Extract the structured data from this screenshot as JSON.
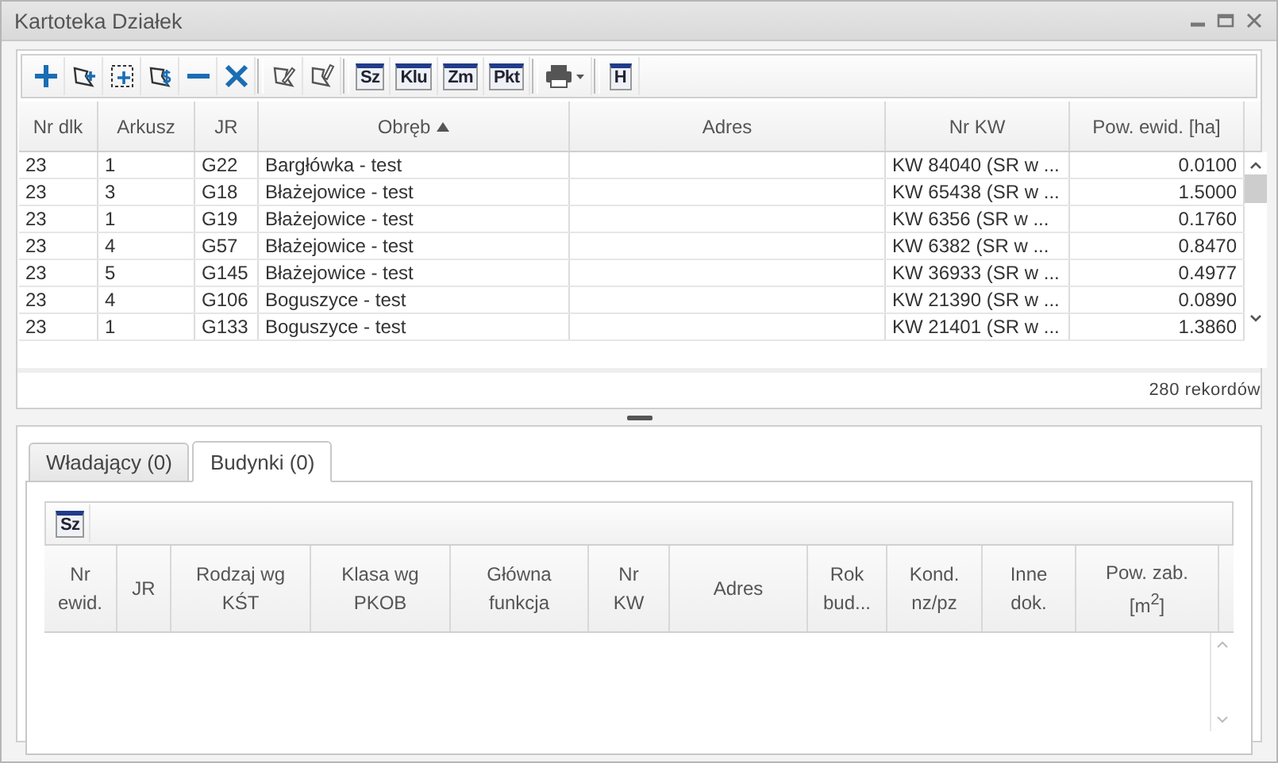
{
  "window": {
    "title": "Kartoteka Działek"
  },
  "toolbar": {
    "labels": [
      "Sz",
      "Klu",
      "Zm",
      "Pkt",
      "H"
    ]
  },
  "table": {
    "columns": [
      {
        "label": "Nr dlk",
        "sorted": false
      },
      {
        "label": "Arkusz",
        "sorted": false
      },
      {
        "label": "JR",
        "sorted": false
      },
      {
        "label": "Obręb",
        "sorted": true
      },
      {
        "label": "Adres",
        "sorted": false
      },
      {
        "label": "Nr KW",
        "sorted": false
      },
      {
        "label": "Pow. ewid. [ha]",
        "sorted": false
      }
    ],
    "rows": [
      [
        "23",
        "1",
        "G22",
        "Bargłówka - test",
        "",
        "KW 84040 (SR w ...",
        "0.0100"
      ],
      [
        "23",
        "3",
        "G18",
        "Błażejowice - test",
        "",
        "KW 65438 (SR w ...",
        "1.5000"
      ],
      [
        "23",
        "1",
        "G19",
        "Błażejowice - test",
        "",
        "KW 6356 (SR w ...",
        "0.1760"
      ],
      [
        "23",
        "4",
        "G57",
        "Błażejowice - test",
        "",
        "KW 6382 (SR w ...",
        "0.8470"
      ],
      [
        "23",
        "5",
        "G145",
        "Błażejowice - test",
        "",
        "KW 36933 (SR w ...",
        "0.4977"
      ],
      [
        "23",
        "4",
        "G106",
        "Boguszyce - test",
        "",
        "KW 21390 (SR w ...",
        "0.0890"
      ],
      [
        "23",
        "1",
        "G133",
        "Boguszyce - test",
        "",
        "KW 21401 (SR w ...",
        "1.3860"
      ]
    ],
    "record_count": "280 rekordów"
  },
  "tabs": [
    {
      "label": "Władający (0)",
      "selected": false
    },
    {
      "label": "Budynki (0)",
      "selected": true
    }
  ],
  "buildings": {
    "toolbar": {
      "labels": [
        "Sz"
      ]
    },
    "columns": [
      "Nr\newid.",
      "JR",
      "Rodzaj wg\nKŚT",
      "Klasa wg\nPKOB",
      "Główna\nfunkcja",
      "Nr\nKW",
      "Adres",
      "Rok\nbud...",
      "Kond.\nnz/pz",
      "Inne\ndok.",
      "Pow. zab.\n[m$^{2}$]"
    ]
  }
}
